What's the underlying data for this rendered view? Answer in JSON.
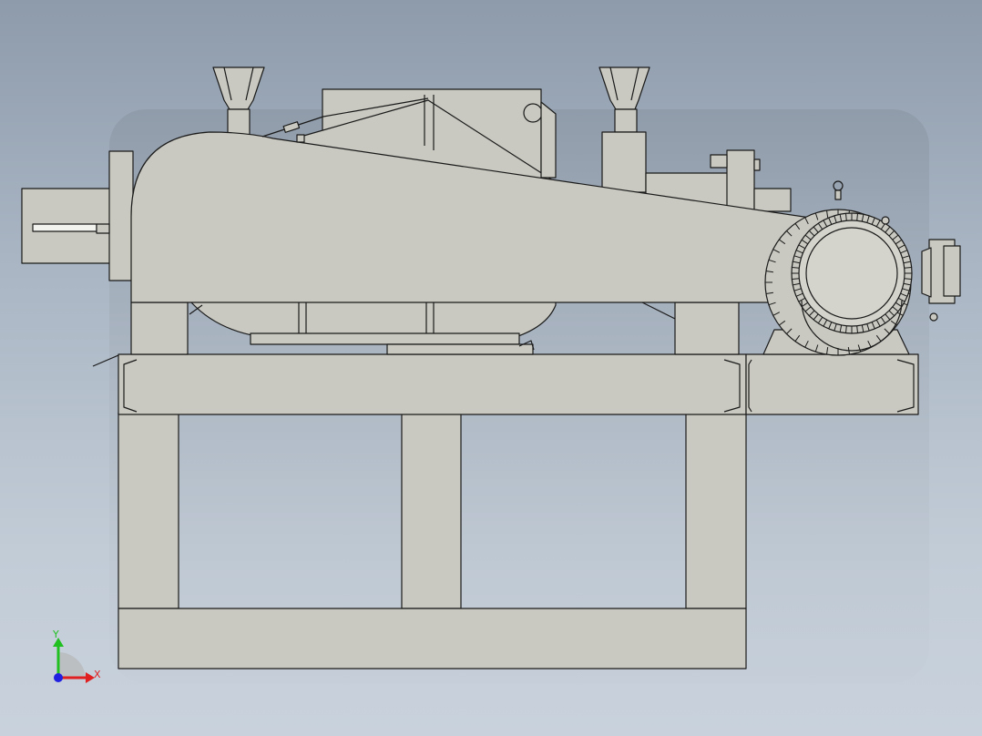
{
  "viewport": {
    "background_top": "#8e9bab",
    "background_bottom": "#c9d2dc"
  },
  "model": {
    "body_color": "#c9c9c1",
    "shadow_color": "#b3b3ab",
    "edge_color": "#1a1a1a",
    "motor_fan_teeth": 64,
    "flywheel_teeth": 40
  },
  "triad": {
    "x_label": "X",
    "y_label": "Y",
    "x_color": "#e02020",
    "y_color": "#20c020",
    "z_color": "#2020e0"
  }
}
